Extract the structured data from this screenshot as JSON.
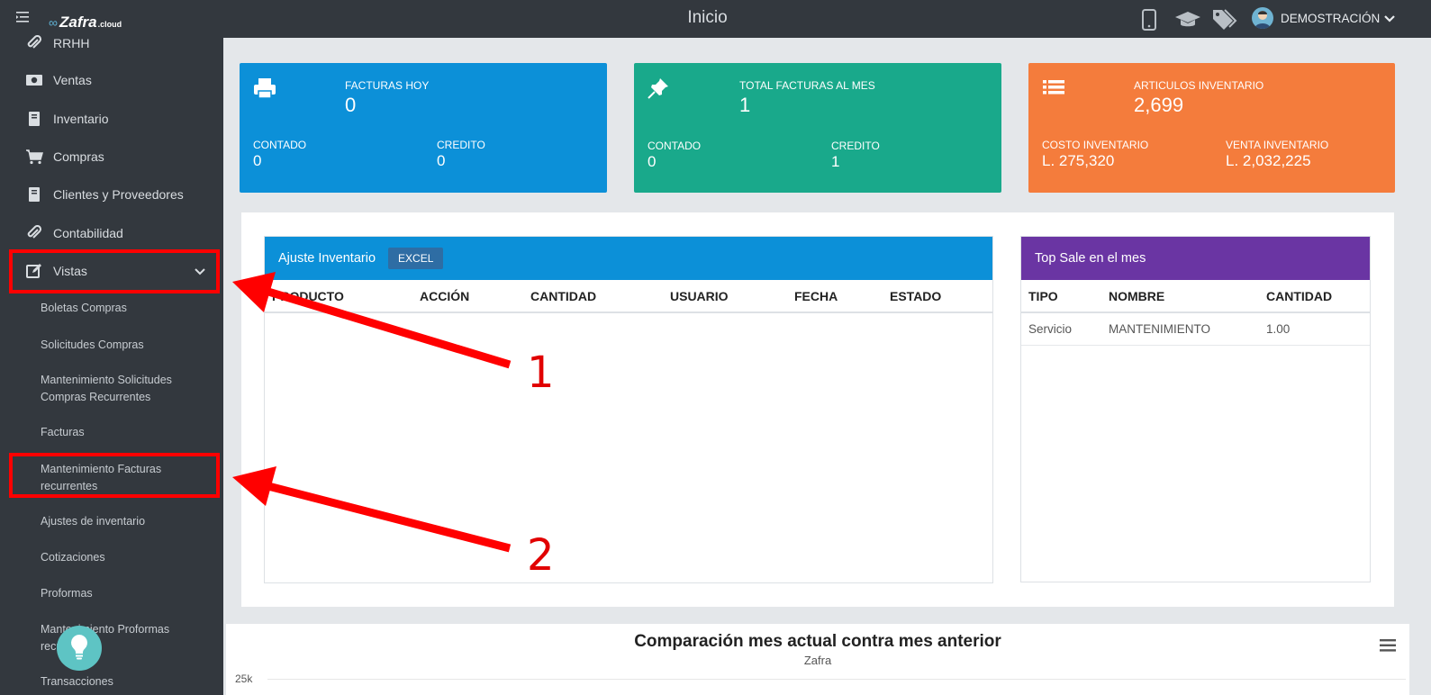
{
  "app": {
    "page_title": "Inicio",
    "logo": {
      "name": "Zafra",
      "suffix": ".cloud"
    }
  },
  "user": {
    "name": "DEMOSTRACIÓN"
  },
  "sidebar": {
    "items": [
      {
        "label": "RRHH",
        "icon": "paperclip-icon"
      },
      {
        "label": "Ventas",
        "icon": "cash-icon"
      },
      {
        "label": "Inventario",
        "icon": "book-icon"
      },
      {
        "label": "Compras",
        "icon": "cart-icon"
      },
      {
        "label": "Clientes y Proveedores",
        "icon": "book-icon"
      },
      {
        "label": "Contabilidad",
        "icon": "paperclip-icon"
      },
      {
        "label": "Vistas",
        "icon": "edit-icon",
        "expanded": true
      }
    ],
    "subitems": [
      "Boletas Compras",
      "Solicitudes Compras",
      "Mantenimiento Solicitudes Compras Recurrentes",
      "Facturas",
      "Mantenimiento Facturas recurrentes",
      "Ajustes de inventario",
      "Cotizaciones",
      "Proformas",
      "Mantenimiento Proformas recurrentes",
      "Transacciones"
    ]
  },
  "cards": [
    {
      "icon": "printer-icon",
      "color": "#0c90d8",
      "label": "FACTURAS HOY",
      "value": "0",
      "sub1_label": "CONTADO",
      "sub1_value": "0",
      "sub2_label": "CREDITO",
      "sub2_value": "0"
    },
    {
      "icon": "pin-icon",
      "color": "#19a98b",
      "label": "TOTAL FACTURAS AL MES",
      "value": "1",
      "sub1_label": "CONTADO",
      "sub1_value": "0",
      "sub2_label": "CREDITO",
      "sub2_value": "1"
    },
    {
      "icon": "list-icon",
      "color": "#f47c3c",
      "label": "ARTICULOS INVENTARIO",
      "value": "2,699",
      "sub1_label": "COSTO INVENTARIO",
      "sub1_value": "L. 275,320",
      "sub2_label": "VENTA INVENTARIO",
      "sub2_value": "L. 2,032,225"
    }
  ],
  "ajuste": {
    "title": "Ajuste Inventario",
    "excel": "EXCEL",
    "columns": [
      "PRODUCTO",
      "ACCIÓN",
      "CANTIDAD",
      "USUARIO",
      "FECHA",
      "ESTADO"
    ]
  },
  "topsale": {
    "title": "Top Sale en el mes",
    "columns": [
      "TIPO",
      "NOMBRE",
      "CANTIDAD"
    ],
    "rows": [
      [
        "Servicio",
        "MANTENIMIENTO",
        "1.00"
      ]
    ]
  },
  "chart": {
    "title": "Comparación mes actual contra mes anterior",
    "subtitle": "Zafra",
    "y_tick": "25k"
  },
  "annotations": [
    "1",
    "2"
  ],
  "colors": {
    "sidebar": "#33383e",
    "ajuste_header": "#0c90d8",
    "topsale_header": "#6a35a3",
    "highlight": "#ff0000"
  }
}
